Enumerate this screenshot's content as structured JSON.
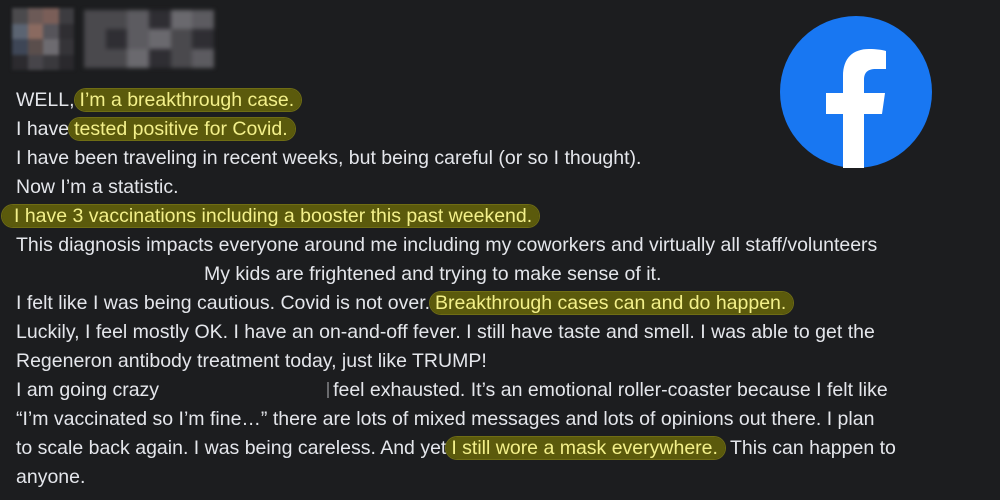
{
  "post": {
    "lines": {
      "l1_a": "WELL,",
      "l1_hl": "I’m a breakthrough case.",
      "l2_a": "I have",
      "l2_hl": "tested positive for Covid.",
      "l3": "I have been traveling in recent weeks, but being careful (or so I thought).",
      "l4": "Now I’m a statistic.",
      "l5_hl": "I have 3 vaccinations including a booster this past weekend.",
      "l6": "This diagnosis impacts everyone around me including my coworkers and virtually all staff/volunteers",
      "l7": "My kids are frightened and trying to make sense of it.",
      "l8_a": "I felt like I was being cautious. Covid is not over.",
      "l8_hl": "Breakthrough cases can and do happen.",
      "l9": "Luckily, I feel mostly OK. I have an on-and-off fever. I still have taste and smell. I was able to get the",
      "l10": "Regeneron antibody treatment today, just like TRUMP!",
      "l11_a": "I am going crazy",
      "l11_b": "feel exhausted. It’s an emotional roller-coaster because I felt like",
      "l12": "“I’m vaccinated so I’m fine…”  there are lots of mixed messages and lots of opinions out there. I plan",
      "l13": "to scale back again. I was being careless. And yet",
      "l13_hl": "I still wore a mask everywhere.",
      "l13_b": " This can happen to",
      "l14": "anyone."
    }
  },
  "logo": {
    "icon": "facebook-logo-icon",
    "color": "#1877f2"
  },
  "colors": {
    "highlight_bg": "#5b5a0c",
    "highlight_text": "#f3f08a",
    "text": "#e4e6eb",
    "background": "#1c1d1f"
  }
}
